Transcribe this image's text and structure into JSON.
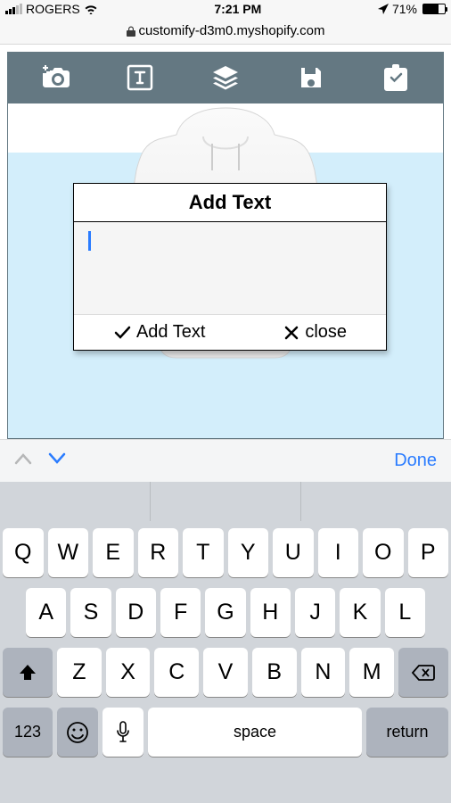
{
  "status": {
    "carrier": "ROGERS",
    "time": "7:21 PM",
    "battery_pct": "71%"
  },
  "browser": {
    "url": "customify-d3m0.myshopify.com"
  },
  "modal": {
    "title": "Add Text",
    "input_value": "",
    "confirm": "Add Text",
    "close": "close"
  },
  "accessory": {
    "done": "Done"
  },
  "keyboard": {
    "row1": [
      "Q",
      "W",
      "E",
      "R",
      "T",
      "Y",
      "U",
      "I",
      "O",
      "P"
    ],
    "row2": [
      "A",
      "S",
      "D",
      "F",
      "G",
      "H",
      "J",
      "K",
      "L"
    ],
    "row3": [
      "Z",
      "X",
      "C",
      "V",
      "B",
      "N",
      "M"
    ],
    "numbers": "123",
    "space": "space",
    "return": "return"
  }
}
